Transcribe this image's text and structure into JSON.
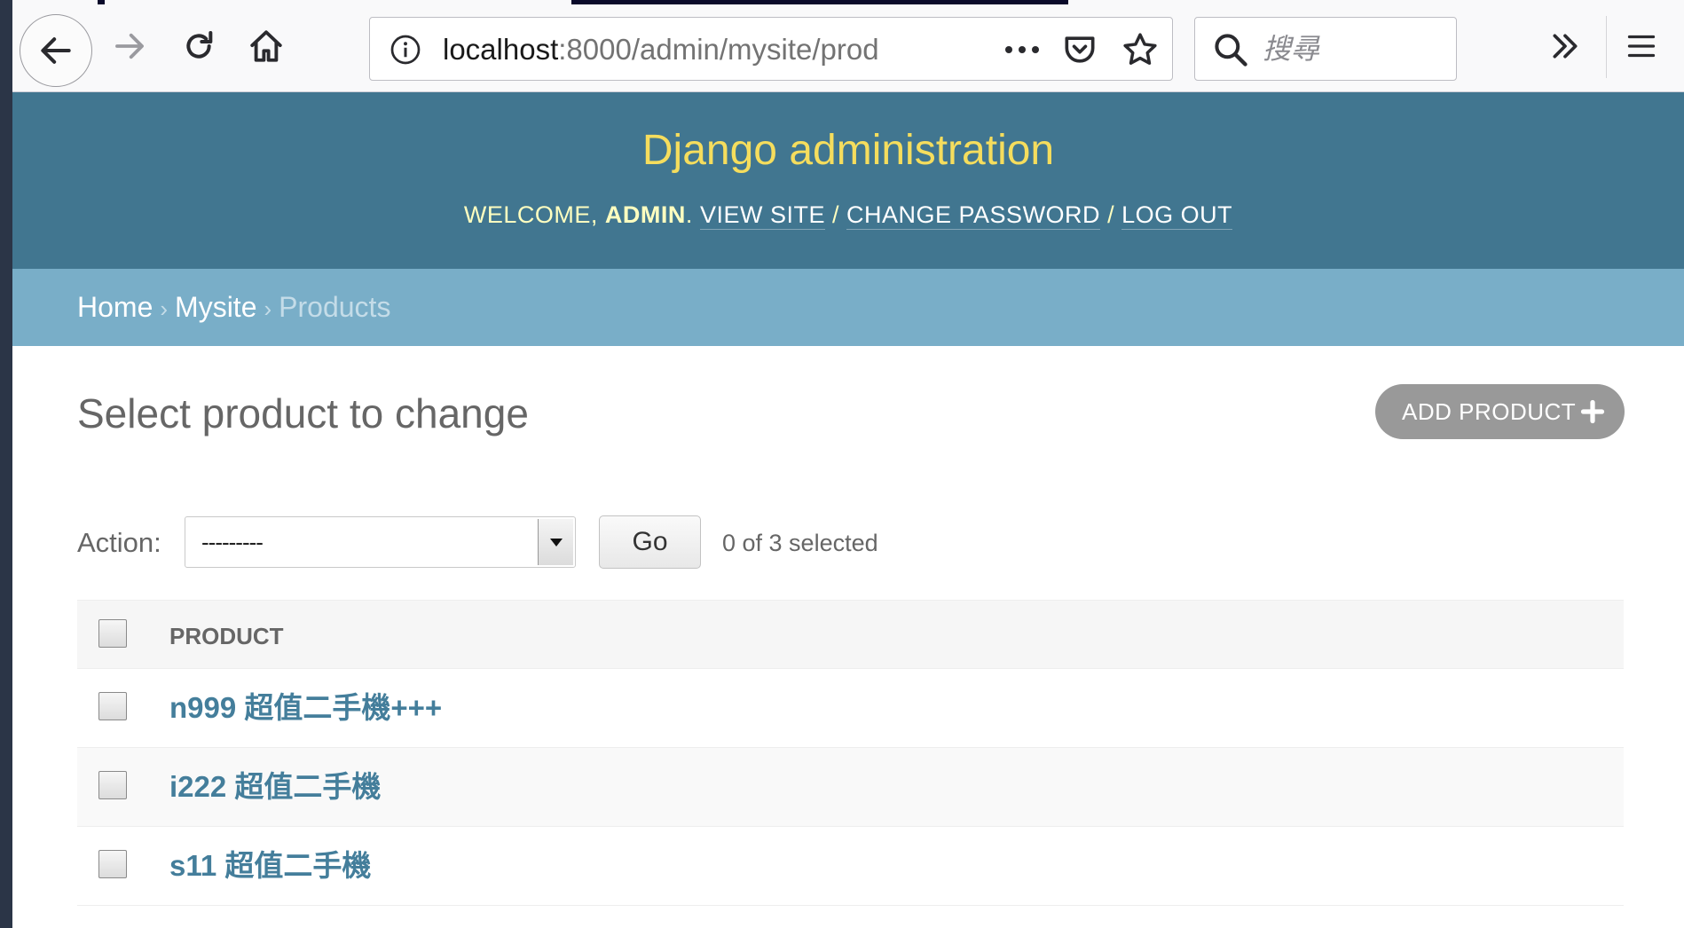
{
  "browser": {
    "url_host": "localhost",
    "url_rest": ":8000/admin/mysite/prod",
    "search_placeholder": "搜尋"
  },
  "header": {
    "branding": "Django administration",
    "welcome_prefix": "Welcome,",
    "username": "admin",
    "links": {
      "view_site": "View site",
      "change_password": "Change password",
      "log_out": "Log out"
    },
    "separator": "/"
  },
  "breadcrumbs": {
    "home": "Home",
    "app": "Mysite",
    "current": "Products",
    "separator": "›"
  },
  "content": {
    "title": "Select product to change",
    "add_button": "Add product"
  },
  "actions": {
    "label": "Action:",
    "selected_value": "---------",
    "go_button": "Go",
    "counter": "0 of 3 selected"
  },
  "table": {
    "column_header": "Product",
    "rows": [
      {
        "name": "n999 超值二手機+++"
      },
      {
        "name": "i222 超值二手機"
      },
      {
        "name": "s11 超值二手機"
      }
    ]
  },
  "colors": {
    "header_bg": "#417690",
    "branding": "#f5dd5d",
    "breadcrumb_bg": "#79aec8",
    "link": "#447e9b",
    "add_button_bg": "#999999"
  }
}
